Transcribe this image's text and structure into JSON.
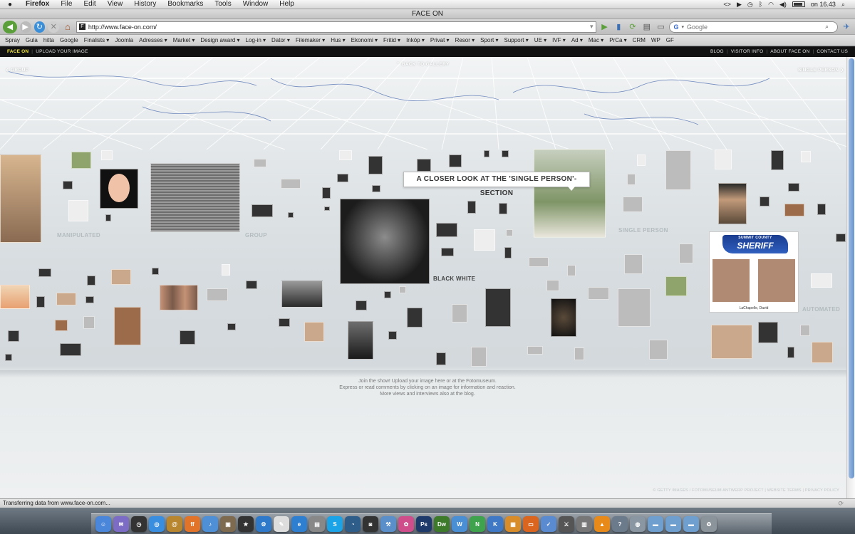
{
  "menubar": {
    "app": "Firefox",
    "items": [
      "File",
      "Edit",
      "View",
      "History",
      "Bookmarks",
      "Tools",
      "Window",
      "Help"
    ],
    "clock": "on 16.43"
  },
  "window": {
    "title": "FACE ON"
  },
  "navbar": {
    "url": "http://www.face-on.com/",
    "search_placeholder": "Google",
    "search_engine_icon": "G"
  },
  "bookmarks": [
    "Spray",
    "Gula",
    "hitta",
    "Google",
    "Finalists ▾",
    "Joomla",
    "Adresses ▾",
    "Market ▾",
    "Design award ▾",
    "Log-in ▾",
    "Dator ▾",
    "Filemaker ▾",
    "Hus ▾",
    "Ekonomi ▾",
    "Fritid ▾",
    "Inköp ▾",
    "Privat ▾",
    "Resor ▾",
    "Sport ▾",
    "Support ▾",
    "UE ▾",
    "IVF ▾",
    "Ad ▾",
    "Mac ▾",
    "PrCa ▾",
    "CRM",
    "WP",
    "GF"
  ],
  "site": {
    "brand": "FACE ON",
    "left_links": [
      "UPLOAD YOUR IMAGE"
    ],
    "right_links": [
      "BLOG",
      "VISITOR INFO",
      "ABOUT FACE ON",
      "CONTACT US"
    ]
  },
  "gallery": {
    "nav_left": "GROUP",
    "nav_center": "BACK TO GALLERY",
    "nav_right": "SINGLE PERSON",
    "sections": {
      "manipulated": "MANIPULATED",
      "group": "GROUP",
      "black_white": "BLACK WHITE",
      "single_person": "SINGLE PERSON",
      "automated": "AUTOMATED"
    },
    "callout": "A CLOSER LOOK AT THE 'SINGLE PERSON'-SECTION",
    "sheriff": {
      "line1": "SUMMIT COUNTY",
      "line2": "SHERIFF",
      "caption": "LaChapelle, David"
    },
    "info_lines": [
      "Join the show! Upload your image here or at the Fotomuseum.",
      "Express or read comments by clicking on an image for information and reaction.",
      "More views and interviews also at the blog."
    ],
    "footer": "© GETTY IMAGES / FOTOMUSEUM ANTWERP PROJECT | WEBSITE TERMS | PRIVACY POLICY"
  },
  "statusbar": {
    "text": "Transferring data from www.face-on.com..."
  },
  "dock": {
    "apps": [
      {
        "name": "finder",
        "label": "☺",
        "color": "#4a86d9"
      },
      {
        "name": "mail",
        "label": "✉",
        "color": "#7d6cc5"
      },
      {
        "name": "dashboard",
        "label": "◷",
        "color": "#333333"
      },
      {
        "name": "safari",
        "label": "◎",
        "color": "#3a8ee0"
      },
      {
        "name": "address-book",
        "label": "@",
        "color": "#b8862e"
      },
      {
        "name": "firefox",
        "label": "ff",
        "color": "#e2742a"
      },
      {
        "name": "itunes",
        "label": "♪",
        "color": "#4f8fd5"
      },
      {
        "name": "iphoto",
        "label": "▣",
        "color": "#7e6a4f"
      },
      {
        "name": "imovie",
        "label": "★",
        "color": "#333333"
      },
      {
        "name": "itools",
        "label": "⚙",
        "color": "#2e79c9"
      },
      {
        "name": "textedit",
        "label": "✎",
        "color": "#dddddd"
      },
      {
        "name": "ie",
        "label": "e",
        "color": "#2f7fd1"
      },
      {
        "name": "preview",
        "label": "▤",
        "color": "#888888"
      },
      {
        "name": "skype",
        "label": "S",
        "color": "#1aa3e6"
      },
      {
        "name": "timemachine",
        "label": "◔",
        "color": "#2f5d8a"
      },
      {
        "name": "photobooth",
        "label": "◙",
        "color": "#333333"
      },
      {
        "name": "xcode",
        "label": "⚒",
        "color": "#5b8fc9"
      },
      {
        "name": "flower",
        "label": "✿",
        "color": "#d04d8b"
      },
      {
        "name": "photoshop",
        "label": "Ps",
        "color": "#1e3a6b"
      },
      {
        "name": "dreamweaver",
        "label": "Dw",
        "color": "#3d7a2a"
      },
      {
        "name": "pages",
        "label": "W",
        "color": "#4a8fd3"
      },
      {
        "name": "numbers",
        "label": "N",
        "color": "#3fa34d"
      },
      {
        "name": "keynote",
        "label": "K",
        "color": "#3f78c4"
      },
      {
        "name": "calendar",
        "label": "▦",
        "color": "#d98c2a"
      },
      {
        "name": "presenter",
        "label": "▭",
        "color": "#d9651f"
      },
      {
        "name": "script",
        "label": "✓",
        "color": "#5a8bd0"
      },
      {
        "name": "utility",
        "label": "⚔",
        "color": "#555555"
      },
      {
        "name": "database",
        "label": "▥",
        "color": "#777777"
      },
      {
        "name": "vlc",
        "label": "▲",
        "color": "#e88a1a"
      },
      {
        "name": "help",
        "label": "?",
        "color": "#6b7b8c"
      },
      {
        "name": "network",
        "label": "◍",
        "color": "#8a97a3"
      },
      {
        "name": "folder-1",
        "label": "▬",
        "color": "#6f9fcf"
      },
      {
        "name": "folder-2",
        "label": "▬",
        "color": "#6f9fcf"
      },
      {
        "name": "folder-3",
        "label": "▬",
        "color": "#6f9fcf"
      },
      {
        "name": "trash",
        "label": "♻",
        "color": "#8c949b"
      }
    ]
  }
}
